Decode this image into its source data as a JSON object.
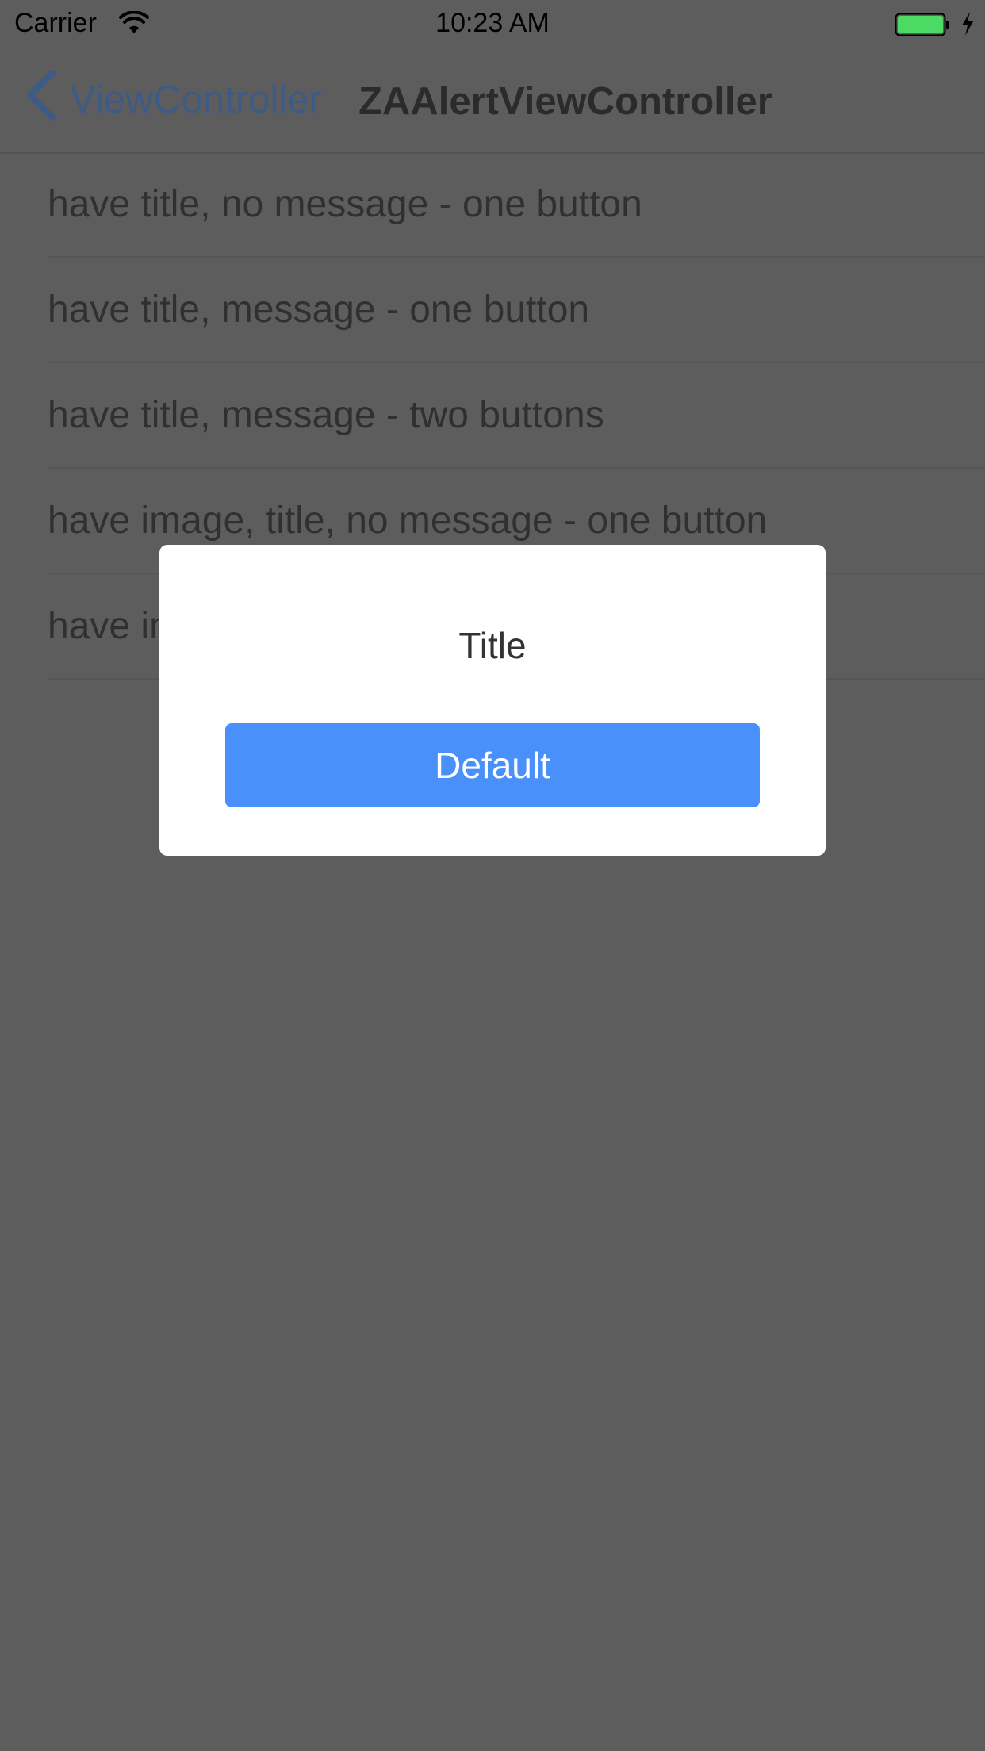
{
  "status_bar": {
    "carrier": "Carrier",
    "time": "10:23 AM",
    "wifi_icon": "wifi-icon",
    "battery_icon": "battery-icon",
    "charging_icon": "charging-bolt-icon",
    "battery_color": "#4cd964"
  },
  "nav": {
    "back_label": "ViewController",
    "title": "ZAAlertViewController",
    "accent_color": "#3d5b86"
  },
  "list": {
    "items": [
      {
        "label": "have title, no message - one button"
      },
      {
        "label": "have title, message - one button"
      },
      {
        "label": "have title, message - two buttons"
      },
      {
        "label": "have image, title, no message - one button"
      },
      {
        "label": "have image, title, message - two buttons"
      }
    ]
  },
  "alert": {
    "title": "Title",
    "button_label": "Default",
    "button_color": "#4a90fb"
  }
}
